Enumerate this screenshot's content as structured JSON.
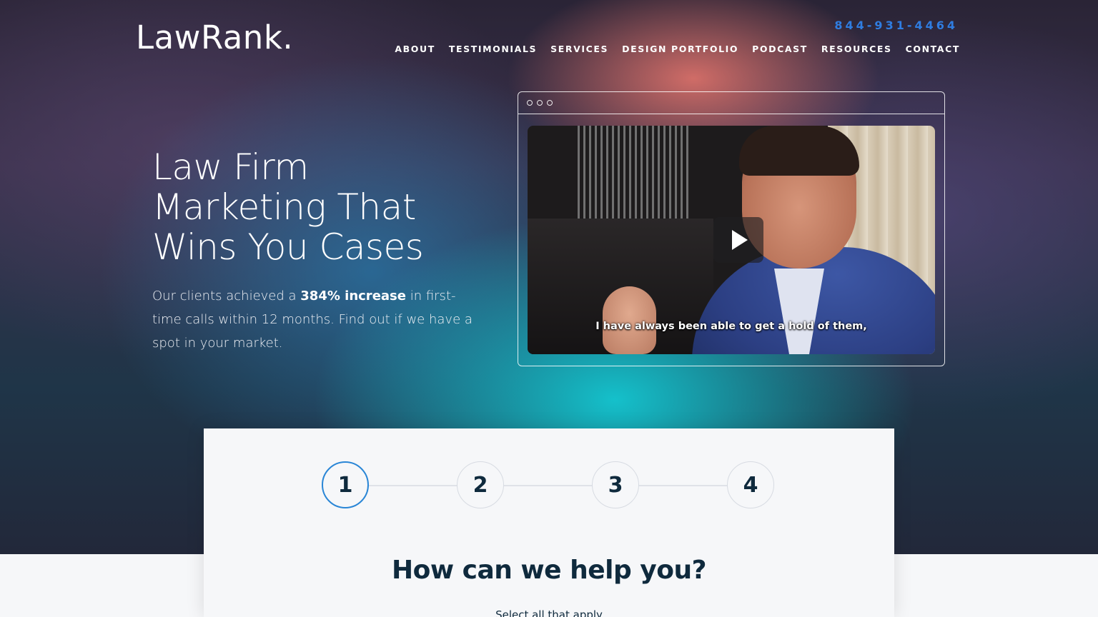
{
  "brand": {
    "logo": "LawRank."
  },
  "header": {
    "phone": "844-931-4464",
    "nav": [
      "ABOUT",
      "TESTIMONIALS",
      "SERVICES",
      "DESIGN PORTFOLIO",
      "PODCAST",
      "RESOURCES",
      "CONTACT"
    ]
  },
  "hero": {
    "headline_lines": [
      "Law Firm",
      "Marketing That",
      "Wins You Cases"
    ],
    "sub_before": "Our clients achieved a ",
    "sub_bold": "384% increase",
    "sub_after": " in first-time calls within 12 months. Find out if we have a spot in your market."
  },
  "video": {
    "caption": "I have always been able to get a hold of them,",
    "play_icon": "play-icon"
  },
  "form": {
    "steps": [
      "1",
      "2",
      "3",
      "4"
    ],
    "active_step": 1,
    "title": "How can we help you?",
    "subtitle": "Select all that apply"
  },
  "colors": {
    "phone": "#2f7de1",
    "active_step_border": "#2a86d6",
    "heading_dark": "#0f2a3d"
  }
}
